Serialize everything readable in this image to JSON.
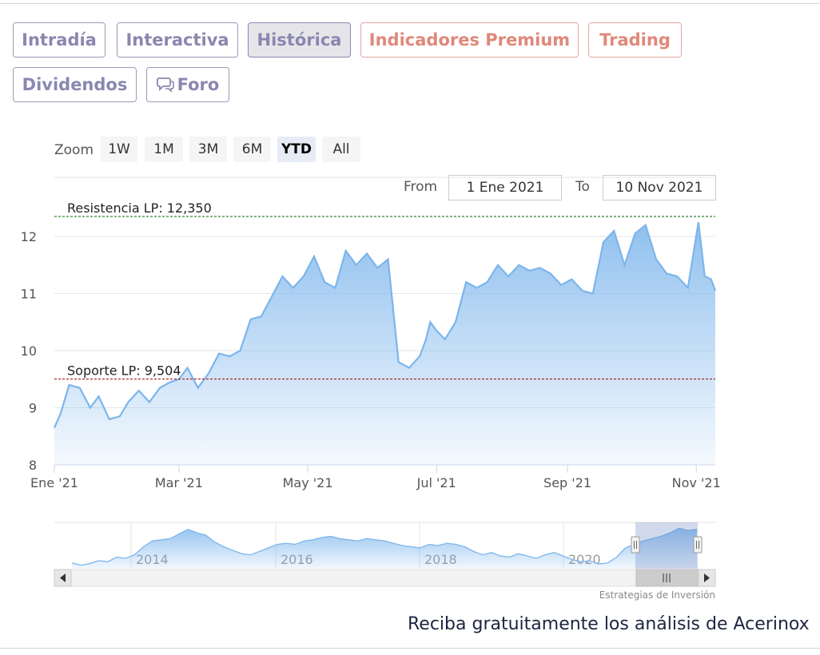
{
  "tabs": [
    {
      "label": "Intradía"
    },
    {
      "label": "Interactiva"
    },
    {
      "label": "Histórica"
    },
    {
      "label": "Indicadores Premium"
    },
    {
      "label": "Trading"
    },
    {
      "label": "Dividendos"
    },
    {
      "label": "Foro"
    }
  ],
  "zoom": {
    "label": "Zoom",
    "buttons": [
      "1W",
      "1M",
      "3M",
      "6M",
      "YTD",
      "All"
    ],
    "selected": "YTD"
  },
  "range": {
    "from_label": "From",
    "from_value": "1 Ene 2021",
    "to_label": "To",
    "to_value": "10 Nov 2021"
  },
  "chart_data": {
    "type": "area",
    "x_tick_labels": [
      "Ene '21",
      "Mar '21",
      "May '21",
      "Jul '21",
      "Sep '21",
      "Nov '21"
    ],
    "y_tick_labels": [
      "8",
      "9",
      "10",
      "11",
      "12"
    ],
    "ylim": [
      8,
      12.45
    ],
    "grid": true,
    "legend": "none",
    "series_color": "#7cb5ec",
    "annotations": [
      {
        "label": "Resistencia LP: 12,350",
        "value": 12.35,
        "color": "#2e8b2e"
      },
      {
        "label": "Soporte LP: 9,504",
        "value": 9.504,
        "color": "#a52a2a"
      }
    ],
    "x": [
      "2021-01-01",
      "2021-01-04",
      "2021-01-08",
      "2021-01-13",
      "2021-01-18",
      "2021-01-22",
      "2021-01-27",
      "2021-02-01",
      "2021-02-05",
      "2021-02-10",
      "2021-02-15",
      "2021-02-20",
      "2021-02-25",
      "2021-03-01",
      "2021-03-05",
      "2021-03-10",
      "2021-03-15",
      "2021-03-20",
      "2021-03-25",
      "2021-03-30",
      "2021-04-04",
      "2021-04-09",
      "2021-04-14",
      "2021-04-19",
      "2021-04-24",
      "2021-04-29",
      "2021-05-04",
      "2021-05-09",
      "2021-05-14",
      "2021-05-19",
      "2021-05-24",
      "2021-05-29",
      "2021-06-03",
      "2021-06-08",
      "2021-06-13",
      "2021-06-18",
      "2021-06-23",
      "2021-06-26",
      "2021-06-28",
      "2021-07-01",
      "2021-07-05",
      "2021-07-10",
      "2021-07-15",
      "2021-07-20",
      "2021-07-25",
      "2021-07-30",
      "2021-08-04",
      "2021-08-09",
      "2021-08-14",
      "2021-08-19",
      "2021-08-24",
      "2021-08-29",
      "2021-09-03",
      "2021-09-08",
      "2021-09-13",
      "2021-09-18",
      "2021-09-23",
      "2021-09-28",
      "2021-10-03",
      "2021-10-08",
      "2021-10-13",
      "2021-10-18",
      "2021-10-23",
      "2021-10-28",
      "2021-11-02",
      "2021-11-05",
      "2021-11-08",
      "2021-11-10"
    ],
    "values": [
      8.65,
      8.9,
      9.4,
      9.35,
      9.0,
      9.2,
      8.8,
      8.85,
      9.1,
      9.3,
      9.1,
      9.35,
      9.45,
      9.5,
      9.7,
      9.35,
      9.6,
      9.95,
      9.9,
      10.0,
      10.55,
      10.6,
      10.95,
      11.3,
      11.1,
      11.3,
      11.65,
      11.2,
      11.1,
      11.75,
      11.5,
      11.7,
      11.45,
      11.6,
      9.8,
      9.7,
      9.9,
      10.2,
      10.5,
      10.35,
      10.2,
      10.5,
      11.2,
      11.1,
      11.2,
      11.5,
      11.3,
      11.5,
      11.4,
      11.45,
      11.35,
      11.15,
      11.25,
      11.05,
      11.0,
      11.9,
      12.1,
      11.5,
      12.05,
      12.2,
      11.6,
      11.35,
      11.3,
      11.1,
      12.25,
      11.3,
      11.25,
      11.05
    ]
  },
  "navigator": {
    "year_labels": [
      "2014",
      "2016",
      "2018",
      "2020"
    ],
    "values": [
      9.0,
      8.8,
      8.95,
      9.2,
      9.1,
      9.5,
      9.4,
      9.7,
      10.4,
      10.9,
      11.0,
      11.1,
      11.5,
      11.9,
      11.6,
      11.4,
      10.8,
      10.4,
      10.1,
      9.8,
      9.7,
      10.0,
      10.3,
      10.6,
      10.7,
      10.6,
      10.9,
      11.0,
      11.2,
      11.3,
      11.1,
      11.0,
      10.9,
      11.1,
      11.0,
      10.9,
      10.7,
      10.5,
      10.4,
      10.3,
      10.6,
      10.5,
      10.7,
      10.6,
      10.4,
      10.0,
      9.7,
      9.9,
      9.6,
      9.5,
      9.8,
      9.6,
      9.4,
      9.7,
      9.9,
      9.6,
      9.3,
      9.1,
      9.2,
      8.9,
      9.0,
      9.5,
      10.3,
      10.6,
      10.9,
      11.1,
      11.3,
      11.6,
      12.0,
      11.8,
      11.9
    ]
  },
  "credit": "Estrategias de Inversión",
  "cta": "Reciba gratuitamente los análisis de Acerinox"
}
